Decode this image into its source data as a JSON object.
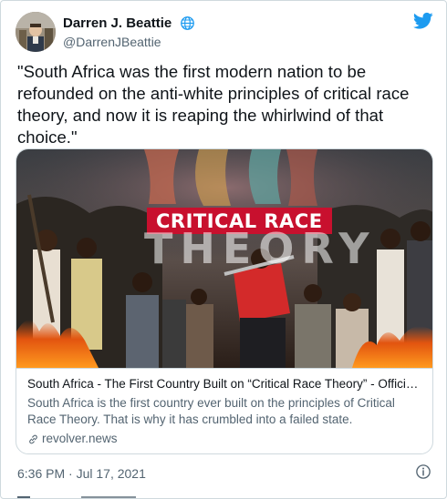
{
  "author": {
    "display_name": "Darren J. Beattie",
    "handle": "@DarrenJBeattie"
  },
  "tweet": {
    "text": "\"South Africa was the first modern nation to be refounded on the anti-white principles of critical race theory, and now it is reaping the whirlwind of that choice.\"",
    "timestamp": "6:36 PM · Jul 17, 2021"
  },
  "card": {
    "image_banner": "CRITICAL RACE",
    "image_subtitle": "THEORY",
    "title": "South Africa - The First Country Built on “Critical Race Theory” - Officiall...",
    "description": "South Africa is the first country ever built on the principles of Critical Race Theory. That is why it has crumbled into a failed state.",
    "domain": "revolver.news"
  },
  "colors": {
    "text_primary": "#0f1419",
    "text_secondary": "#536471",
    "twitter_blue": "#1d9bf0",
    "border": "#cfd9de",
    "banner_red": "#c8102e"
  },
  "icons": [
    "globe-icon",
    "twitter-bird-icon",
    "link-icon",
    "info-icon"
  ]
}
